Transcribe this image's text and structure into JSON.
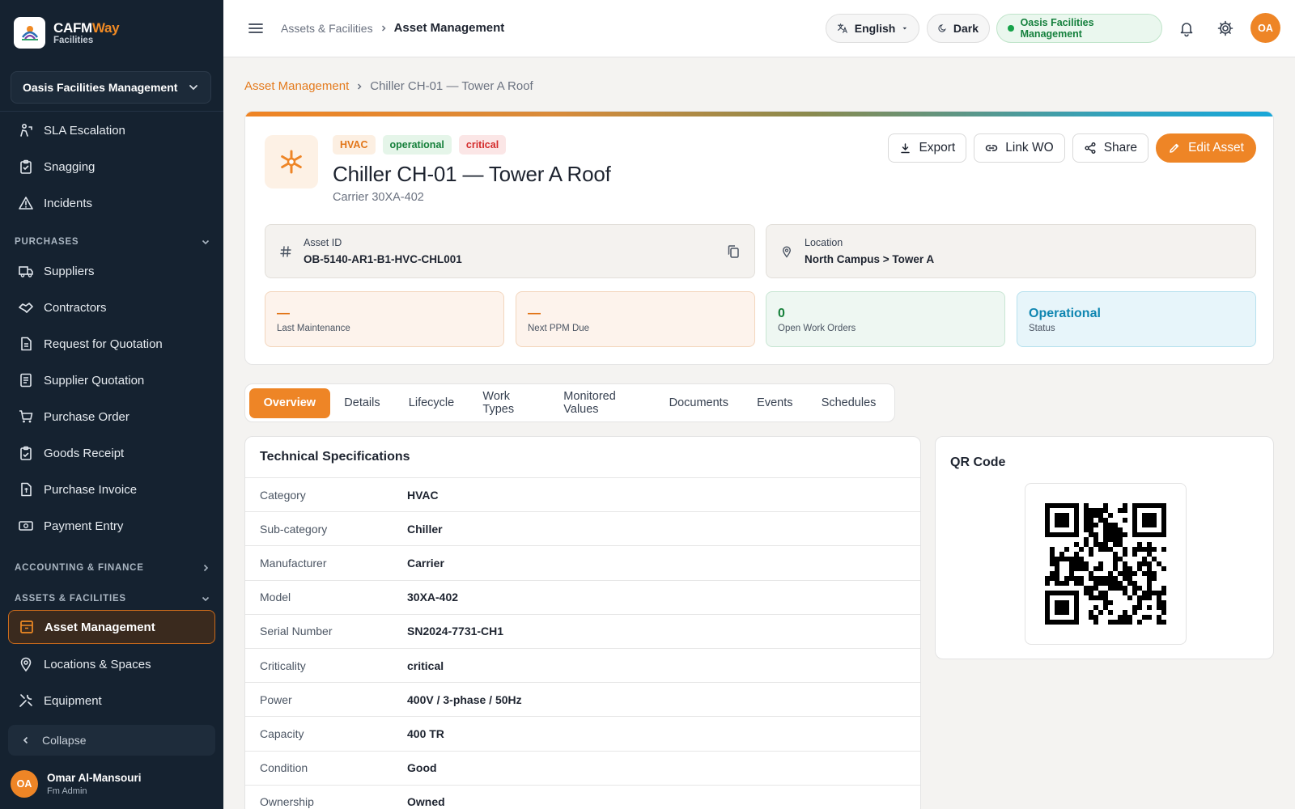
{
  "brand": {
    "name_main": "CAFM",
    "name_accent": "Way",
    "sub": "Facilities"
  },
  "sidebar": {
    "org": "Oasis Facilities Management",
    "items_top": [
      {
        "label": "SLA Escalation",
        "icon": "sla-escalation-icon"
      },
      {
        "label": "Snagging",
        "icon": "clipboard-icon"
      },
      {
        "label": "Incidents",
        "icon": "warning-icon"
      }
    ],
    "section_purchases": "PURCHASES",
    "items_purchases": [
      {
        "label": "Suppliers",
        "icon": "truck-icon"
      },
      {
        "label": "Contractors",
        "icon": "handshake-icon"
      },
      {
        "label": "Request for Quotation",
        "icon": "document-icon"
      },
      {
        "label": "Supplier Quotation",
        "icon": "quotation-icon"
      },
      {
        "label": "Purchase Order",
        "icon": "cart-icon"
      },
      {
        "label": "Goods Receipt",
        "icon": "clipboard-check-icon"
      },
      {
        "label": "Purchase Invoice",
        "icon": "invoice-icon"
      },
      {
        "label": "Payment Entry",
        "icon": "money-icon"
      }
    ],
    "section_accounting": "ACCOUNTING & FINANCE",
    "section_assets": "ASSETS & FACILITIES",
    "items_assets": [
      {
        "label": "Asset Management",
        "icon": "box-icon"
      },
      {
        "label": "Locations & Spaces",
        "icon": "location-pin-icon"
      },
      {
        "label": "Equipment",
        "icon": "tools-icon"
      }
    ],
    "collapse": "Collapse",
    "user": {
      "initials": "OA",
      "name": "Omar Al-Mansouri",
      "role": "Fm Admin"
    }
  },
  "topbar": {
    "crumb_parent": "Assets & Facilities",
    "crumb_current": "Asset Management",
    "language": "English",
    "theme": "Dark",
    "org": "Oasis Facilities Management",
    "avatar": "OA"
  },
  "page": {
    "crumb_link": "Asset Management",
    "crumb_current": "Chiller CH-01 — Tower A Roof"
  },
  "asset": {
    "tags": [
      "HVAC",
      "operational",
      "critical"
    ],
    "title": "Chiller CH-01 — Tower A Roof",
    "subtitle": "Carrier 30XA-402",
    "actions": {
      "export": "Export",
      "link_wo": "Link WO",
      "share": "Share",
      "edit": "Edit Asset"
    },
    "asset_id_label": "Asset ID",
    "asset_id": "OB-5140-AR1-B1-HVC-CHL001",
    "location_label": "Location",
    "location": "North Campus > Tower A",
    "stats": [
      {
        "value": "—",
        "label": "Last Maintenance"
      },
      {
        "value": "—",
        "label": "Next PPM Due"
      },
      {
        "value": "0",
        "label": "Open Work Orders"
      },
      {
        "value": "Operational",
        "label": "Status"
      }
    ]
  },
  "tabs": [
    "Overview",
    "Details",
    "Lifecycle",
    "Work Types",
    "Monitored Values",
    "Documents",
    "Events",
    "Schedules"
  ],
  "specs": {
    "title": "Technical Specifications",
    "rows": [
      {
        "k": "Category",
        "v": "HVAC"
      },
      {
        "k": "Sub-category",
        "v": "Chiller"
      },
      {
        "k": "Manufacturer",
        "v": "Carrier"
      },
      {
        "k": "Model",
        "v": "30XA-402"
      },
      {
        "k": "Serial Number",
        "v": "SN2024-7731-CH1"
      },
      {
        "k": "Criticality",
        "v": "critical"
      },
      {
        "k": "Power",
        "v": "400V / 3-phase / 50Hz"
      },
      {
        "k": "Capacity",
        "v": "400 TR"
      },
      {
        "k": "Condition",
        "v": "Good"
      },
      {
        "k": "Ownership",
        "v": "Owned"
      }
    ]
  },
  "qr": {
    "title": "QR Code"
  },
  "colors": {
    "accent": "#ee8526",
    "sidebar": "#152230",
    "success": "#16803b",
    "danger": "#d42b2b",
    "info": "#0f86b1"
  }
}
